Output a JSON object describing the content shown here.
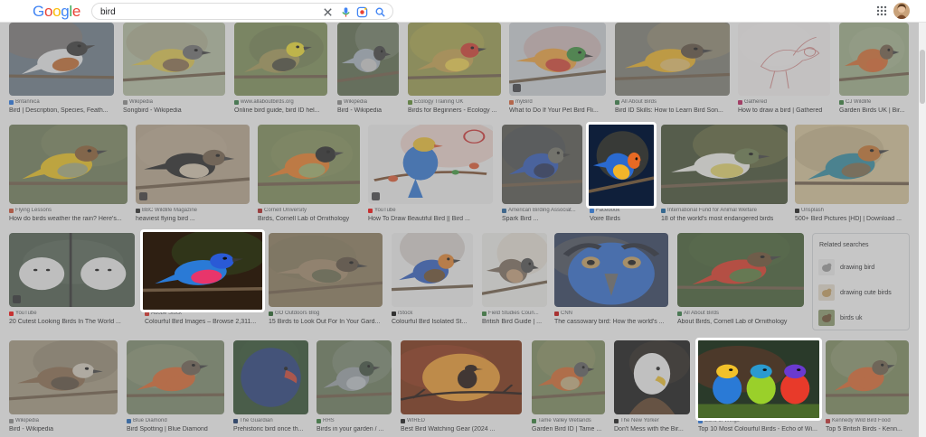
{
  "header": {
    "logo_letters": [
      {
        "ch": "G",
        "color": "#4285f4"
      },
      {
        "ch": "o",
        "color": "#ea4335"
      },
      {
        "ch": "o",
        "color": "#fbbc05"
      },
      {
        "ch": "g",
        "color": "#4285f4"
      },
      {
        "ch": "l",
        "color": "#34a853"
      },
      {
        "ch": "e",
        "color": "#ea4335"
      }
    ],
    "search_value": "bird",
    "icons": [
      "clear-icon",
      "microphone-icon",
      "lens-icon",
      "search-icon",
      "apps-grid-icon",
      "account-avatar"
    ]
  },
  "results": [
    {
      "source": "Britannica",
      "title": "Bird | Description, Species, Feath...",
      "fav": "#1a73e8",
      "palette": [
        "#6b7a88",
        "#eef0f2",
        "#333333",
        "#c46a2b"
      ]
    },
    {
      "source": "Wikipedia",
      "title": "Songbird - Wikipedia",
      "fav": "#8a8a8a",
      "palette": [
        "#b6bfa3",
        "#e0c94a",
        "#6b6b6b",
        "#8b6d4a"
      ]
    },
    {
      "source": "www.allaboutbirds.org",
      "title": "Online bird guide, bird ID hel...",
      "fav": "#2b7a3d",
      "palette": [
        "#7d8f55",
        "#a59a55",
        "#f2e02c",
        "#4a4a3a"
      ]
    },
    {
      "source": "Wikipedia",
      "title": "Bird - Wikipedia",
      "fav": "#8a8a8a",
      "palette": [
        "#5a6a4a",
        "#aab6c2",
        "#3a3a3a",
        "#d0d0d0"
      ]
    },
    {
      "source": "Ecology Training UK",
      "title": "Birds for Beginners - Ecology ...",
      "fav": "#5b8c2a",
      "palette": [
        "#9a9c4a",
        "#c9a34b",
        "#d4372a",
        "#f2d24a"
      ]
    },
    {
      "source": "myBird",
      "title": "What to Do If Your Pet Bird Fli...",
      "fav": "#e05a2b",
      "palette": [
        "#cfd5d9",
        "#f2a33a",
        "#3a8f3a",
        "#d8412f"
      ]
    },
    {
      "source": "All About Birds",
      "title": "Bird ID Skills: How to Learn Bird Son...",
      "fav": "#2b7a3d",
      "palette": [
        "#7c7c72",
        "#f0b321",
        "#5a4a3a",
        "#e8c16a"
      ]
    },
    {
      "source": "Gathered",
      "title": "How to draw a bird | Gathered",
      "fav": "#c2185b",
      "palette": [
        "#faf7f7",
        "#d88a8a",
        "#e3b0b0",
        "#ffffff"
      ]
    },
    {
      "source": "CJ Wildlife",
      "title": "Garden Birds UK | Bir...",
      "fav": "#2e7d32",
      "palette": [
        "#9fb089",
        "#d96b2b",
        "#6e5a44",
        "#c5cbb1"
      ]
    },
    {
      "source": "Flying Lessons",
      "title": "How do birds weather the rain? Here's...",
      "fav": "#d24a2b",
      "palette": [
        "#6f7d56",
        "#f0c419",
        "#8b5a2b",
        "#a7ad7a"
      ]
    },
    {
      "source": "BBC Wildlife Magazine",
      "title": "heaviest flying bird ...",
      "fav": "#222222",
      "palette": [
        "#b8a58c",
        "#1f1f1f",
        "#6e5a44",
        "#d8c9b0"
      ]
    },
    {
      "source": "Cornell University",
      "title": "Birds, Cornell Lab of Ornithology",
      "fav": "#b31b1b",
      "palette": [
        "#7d8c55",
        "#f07c22",
        "#1f1f1f",
        "#a3b16a"
      ]
    },
    {
      "source": "YouTube",
      "title": "How To Draw Beautiful Bird || Bird ...",
      "fav": "#ff0000",
      "palette": [
        "#f5f5f5",
        "#2a74d6",
        "#f2c12e",
        "#e2552b"
      ]
    },
    {
      "source": "American Birding Associat...",
      "title": "Spark Bird ...",
      "fav": "#1a5e9c",
      "palette": [
        "#51514a",
        "#2a55b8",
        "#707064",
        "#1f2d5a"
      ]
    },
    {
      "source": "Facebook",
      "title": "Voire Birds",
      "fav": "#1877f2",
      "palette": [
        "#0f1f3a",
        "#e86a24",
        "#2a6bd0",
        "#f2b52a"
      ]
    },
    {
      "source": "International Fund for Animal Welfare",
      "title": "18 of the world's most endangered birds",
      "fav": "#0a5fa3",
      "palette": [
        "#3e4a2e",
        "#f4f4f0",
        "#6a7a4a",
        "#e7d86a"
      ]
    },
    {
      "source": "Unsplash",
      "title": "500+ Bird Pictures [HD] | Download ...",
      "fav": "#111111",
      "palette": [
        "#d9c79a",
        "#2b8aa0",
        "#c9722a",
        "#7a6a4a"
      ]
    },
    {
      "source": "YouTube",
      "title": "20 Cutest Looking Birds In The World ...",
      "fav": "#ff0000",
      "palette": [
        "#4a5a4a",
        "#f2f2f2",
        "#2a2a2a",
        "#8a9a8a"
      ]
    },
    {
      "source": "Adobe Stock",
      "title": "Colourful Bird Images – Browse 2,311...",
      "fav": "#e2231a",
      "palette": [
        "#2e1f12",
        "#2a7ad6",
        "#e8356b",
        "#3e9a3e"
      ]
    },
    {
      "source": "GO Outdoors Blog",
      "title": "15 Birds to Look Out For In Your Gard...",
      "fav": "#1b5e20",
      "palette": [
        "#8c7a5a",
        "#a48a6a",
        "#5a4a3a",
        "#6a6a4a"
      ]
    },
    {
      "source": "iStock",
      "title": "Colourful Bird Isolated St...",
      "fav": "#000000",
      "palette": [
        "#f4f4f4",
        "#2a5bc2",
        "#e6822a",
        "#6a4a2a"
      ]
    },
    {
      "source": "Field Studies Coun...",
      "title": "British Bird Guide | ...",
      "fav": "#2e7d32",
      "palette": [
        "#f2f2ee",
        "#7a6a5a",
        "#4a4a4a",
        "#c9a07a"
      ]
    },
    {
      "source": "CNN",
      "title": "The cassowary bird: How the world's ...",
      "fav": "#cc0000",
      "palette": [
        "#2a3a5a",
        "#1c2230",
        "#2a6ad2",
        "#c8a060"
      ]
    },
    {
      "source": "All About Birds",
      "title": "About Birds, Cornell Lab of Ornithology",
      "fav": "#2b7a3d",
      "palette": [
        "#3e5a2e",
        "#e0321f",
        "#6a4a2a",
        "#5a7a3a"
      ]
    },
    {
      "source": "Wikipedia",
      "title": "Bird - Wikipedia",
      "fav": "#8a8a8a",
      "palette": [
        "#a59a80",
        "#8a6a4a",
        "#d8cfc0",
        "#5a4a3a"
      ]
    },
    {
      "source": "Blue Diamond",
      "title": "Bird Spotting | Blue Diamond",
      "fav": "#1565c0",
      "palette": [
        "#7a8a6a",
        "#e0662a",
        "#6a5a4a",
        "#c9c0a0"
      ]
    },
    {
      "source": "The Guardian",
      "title": "Prehistoric bird once th...",
      "fav": "#052962",
      "palette": [
        "#2a4a2a",
        "#1f3a7a",
        "#d0412f",
        "#3a6a3a"
      ]
    },
    {
      "source": "RHS",
      "title": "Birds in your garden / ...",
      "fav": "#2e7d32",
      "palette": [
        "#6a7a5a",
        "#9aa2a8",
        "#3a4a3a",
        "#c0c6cc"
      ]
    },
    {
      "source": "WIRED",
      "title": "Best Bird Watching Gear (2024 ...",
      "fav": "#111111",
      "palette": [
        "#7a2a0a",
        "#f29a2a",
        "#1a0a05",
        "#e8502a"
      ]
    },
    {
      "source": "Tame Valley Wetlands",
      "title": "Garden Bird ID | Tame ...",
      "fav": "#2e7d32",
      "palette": [
        "#7a8a5a",
        "#d8682a",
        "#5a5a5a",
        "#c9b080"
      ]
    },
    {
      "source": "The New Yorker",
      "title": "Don't Mess with the Bir...",
      "fav": "#111111",
      "palette": [
        "#111111",
        "#f4f4f4",
        "#f2c12a",
        "#6a4a2a"
      ]
    },
    {
      "source": "Echo of Wings",
      "title": "Top 10 Most Colourful Birds - Echo of Wi...",
      "fav": "#1a73e8",
      "palette": [
        "#2a3a2a",
        "#2a7ad6",
        "#9ad02a",
        "#e83a2a"
      ]
    },
    {
      "source": "Kennedy Wild Bird Food",
      "title": "Top 5 British Birds - Kenn...",
      "fav": "#c62828",
      "palette": [
        "#7a8a5a",
        "#e0662a",
        "#6a5a44",
        "#d8d0c0"
      ]
    }
  ],
  "related": {
    "title": "Related searches",
    "items": [
      "drawing bird",
      "drawing cute birds",
      "birds uk"
    ]
  }
}
